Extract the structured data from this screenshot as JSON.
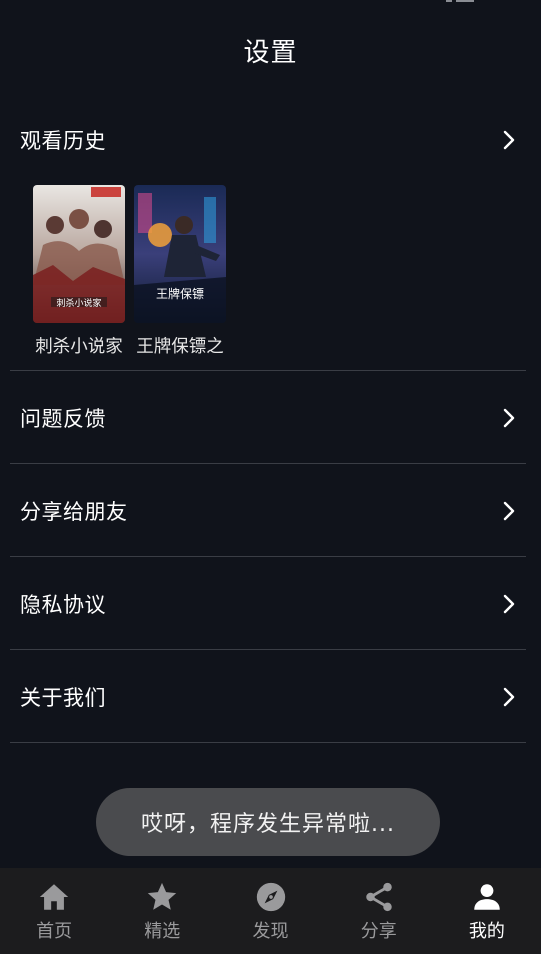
{
  "header": {
    "title": "设置"
  },
  "history": {
    "label": "观看历史",
    "items": [
      {
        "title": "刺杀小说家",
        "poster_caption": "刺杀小说家"
      },
      {
        "title": "王牌保镖之",
        "poster_caption": "王牌保镖"
      }
    ]
  },
  "menu": {
    "feedback": "问题反馈",
    "share_friends": "分享给朋友",
    "privacy": "隐私协议",
    "about": "关于我们"
  },
  "toast": {
    "text": "哎呀，程序发生异常啦..."
  },
  "tabbar": {
    "items": [
      {
        "label": "首页",
        "icon": "home-icon"
      },
      {
        "label": "精选",
        "icon": "star-icon"
      },
      {
        "label": "发现",
        "icon": "compass-icon"
      },
      {
        "label": "分享",
        "icon": "share-icon"
      },
      {
        "label": "我的",
        "icon": "person-icon"
      }
    ],
    "active": "我的"
  },
  "colors": {
    "background": "#10131b",
    "divider": "#3a3d45",
    "tabbar": "#1c1c1e",
    "tab_inactive": "#9a9a9c",
    "tab_active": "#ffffff",
    "toast": "#4a4b4e"
  }
}
